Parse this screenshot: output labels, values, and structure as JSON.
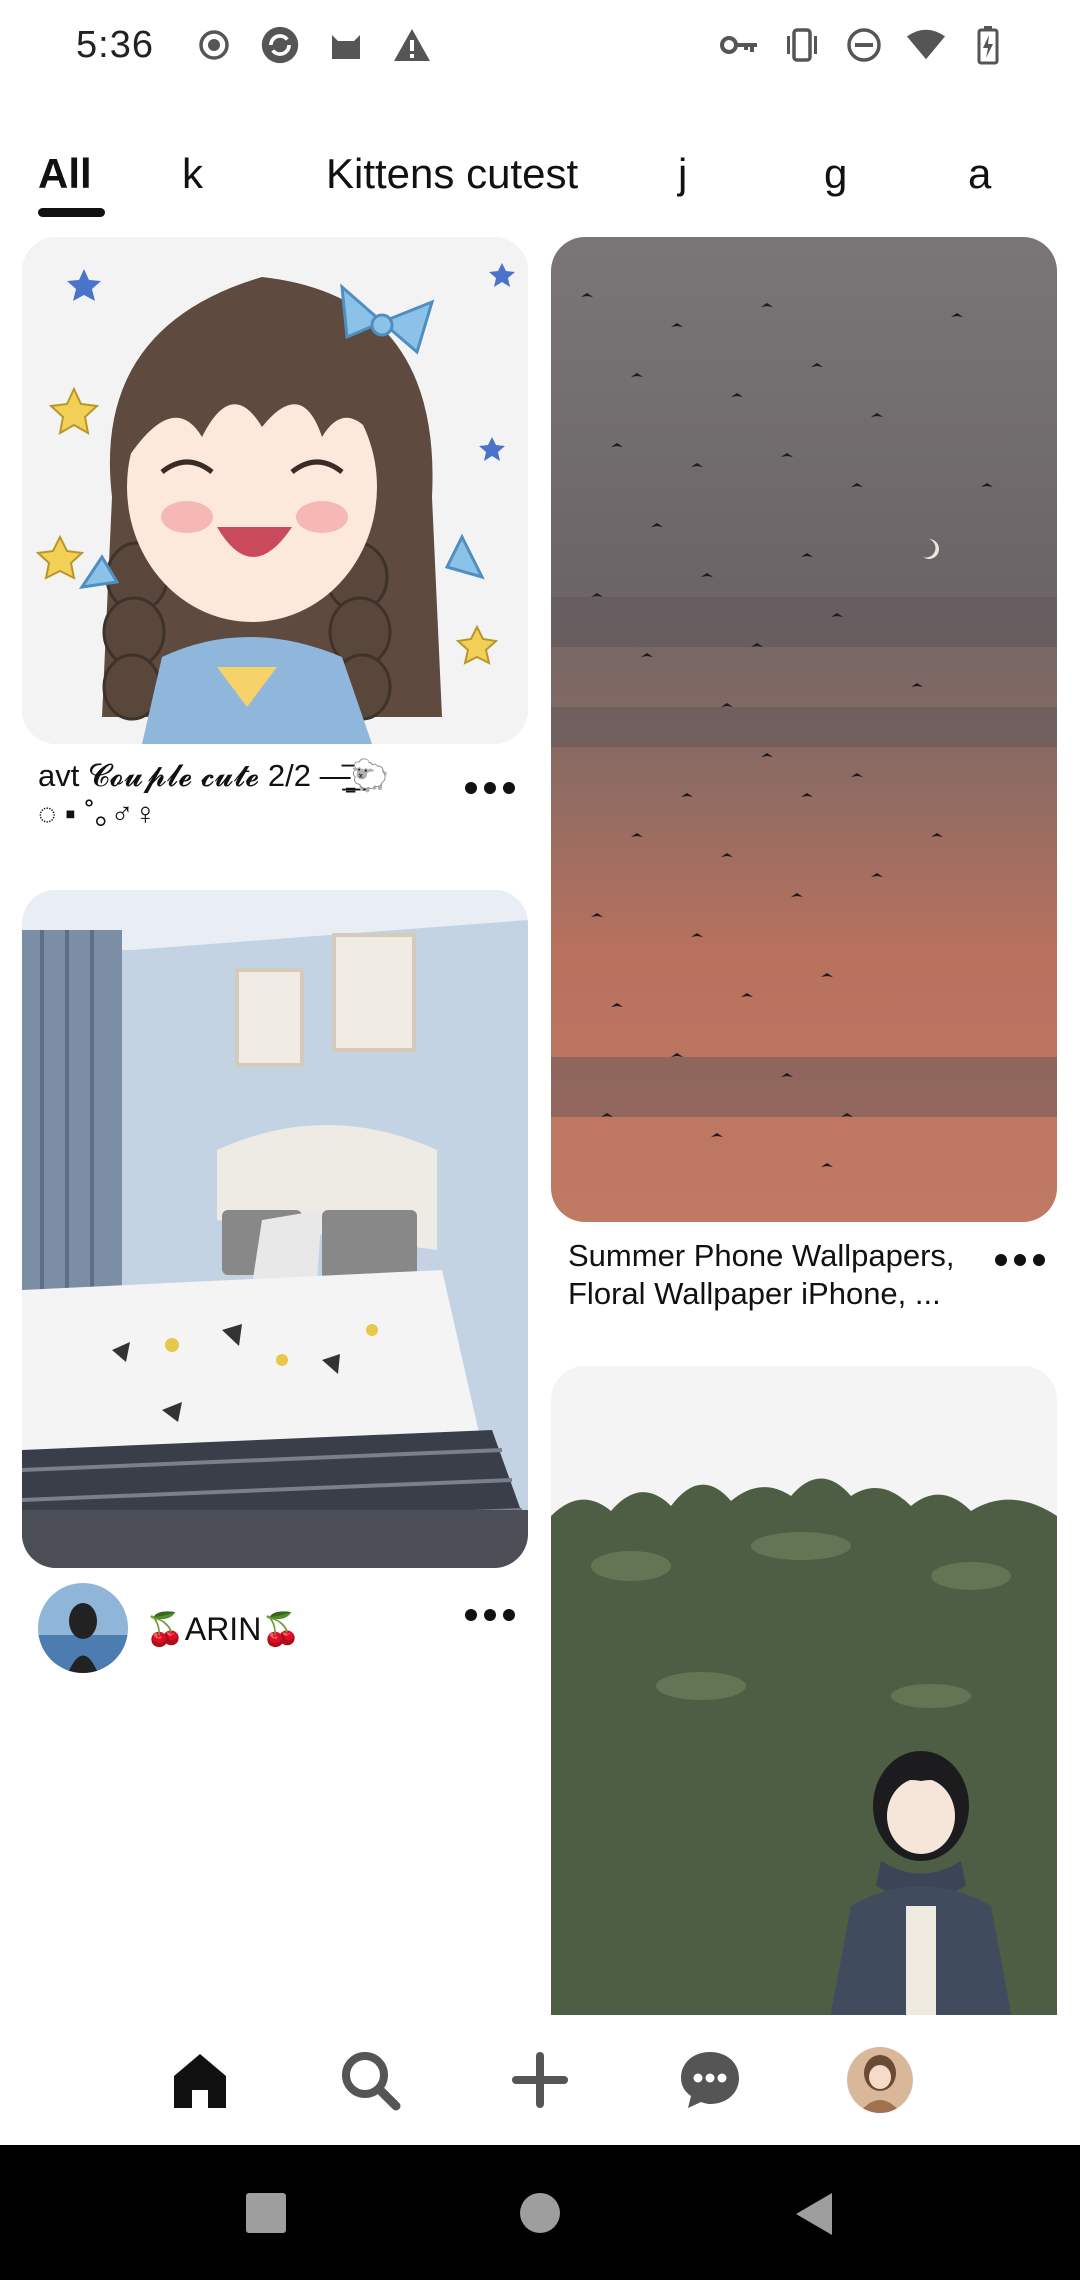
{
  "status": {
    "time": "5:36",
    "left_icons": [
      "record-icon",
      "sync-icon",
      "cat-icon",
      "warning-icon"
    ],
    "right_icons": [
      "key-icon",
      "vibrate-icon",
      "dnd-icon",
      "wifi-icon",
      "battery-charging-icon"
    ]
  },
  "tabs": [
    {
      "label": "All",
      "active": true
    },
    {
      "label": "k",
      "active": false
    },
    {
      "label": "Kittens cutest",
      "active": false
    },
    {
      "label": "j",
      "active": false
    },
    {
      "label": "g",
      "active": false
    },
    {
      "label": "a",
      "active": false
    }
  ],
  "pins": {
    "pin1": {
      "title_line1": "avt 𝓒𝓸𝓾𝓹𝓵𝓮 𝓬𝓾𝓽𝓮 2/2 ―̳͟͞🐑",
      "title_line2": "◌ ▪ ˚｡♂♀"
    },
    "pin2": {
      "title_line1": "Summer Phone Wallpapers,",
      "title_line2": "Floral Wallpaper iPhone, ..."
    },
    "pin3": {
      "author": "🍒ARIN🍒"
    }
  },
  "nav": {
    "items": [
      "home-icon",
      "search-icon",
      "create-icon",
      "messages-icon",
      "profile-avatar"
    ]
  },
  "colors": {
    "accent": "#111111",
    "sky_top": "#6b6b70",
    "sky_bottom": "#c47a62",
    "room_wall": "#c4d3e4",
    "hedge": "#4e5e44"
  }
}
